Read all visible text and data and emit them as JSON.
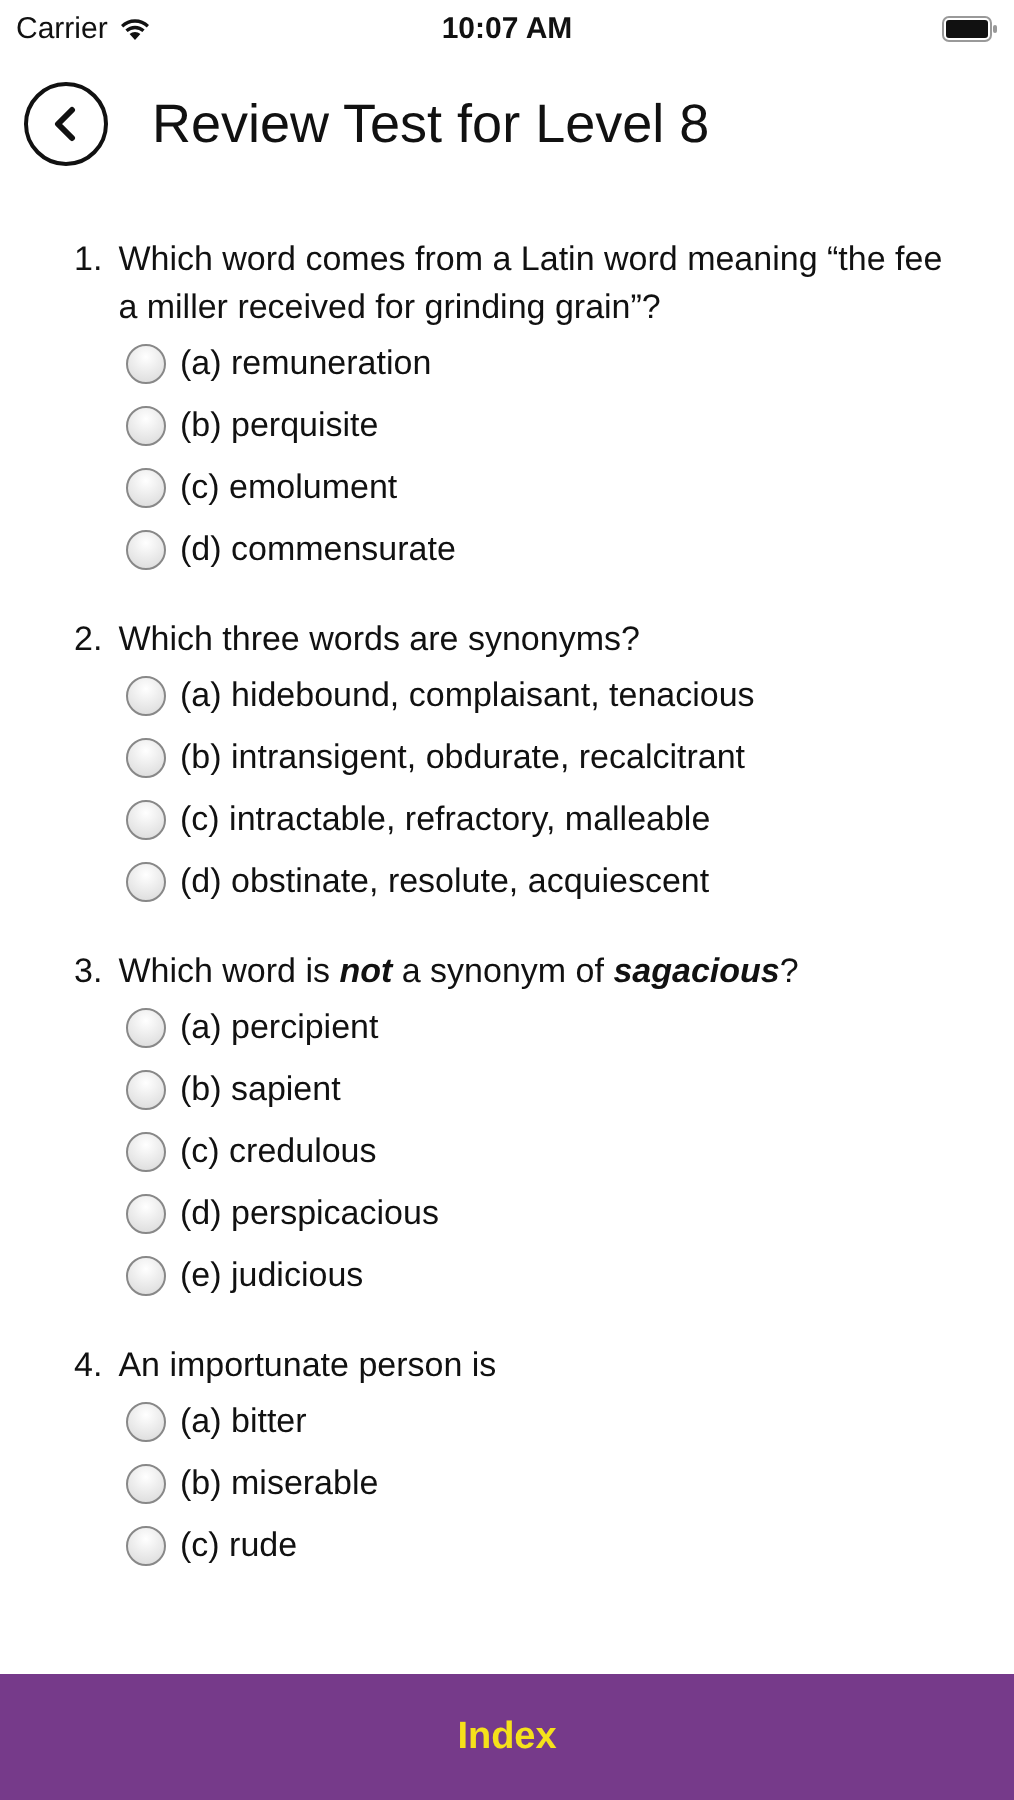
{
  "status_bar": {
    "carrier": "Carrier",
    "time": "10:07 AM"
  },
  "header": {
    "title": "Review Test for Level 8"
  },
  "questions": [
    {
      "number": "1.",
      "text": "Which word comes from a Latin word meaning “the fee a miller received for grinding grain”?",
      "options": [
        {
          "label": "(a) remuneration",
          "selected": false
        },
        {
          "label": "(b) perquisite",
          "selected": false
        },
        {
          "label": "(c) emolument",
          "selected": false
        },
        {
          "label": "(d) commensurate",
          "selected": false
        }
      ]
    },
    {
      "number": "2.",
      "text": "Which three words are synonyms?",
      "options": [
        {
          "label": "(a) hidebound, complaisant, tenacious",
          "selected": false
        },
        {
          "label": "(b) intransigent, obdurate, recalcitrant",
          "selected": false
        },
        {
          "label": "(c) intractable, refractory, malleable",
          "selected": false
        },
        {
          "label": "(d) obstinate, resolute, acquiescent",
          "selected": false
        }
      ]
    },
    {
      "number": "3.",
      "text": "Which word is **not** a synonym of **sagacious**?",
      "options": [
        {
          "label": "(a) percipient",
          "selected": false
        },
        {
          "label": "(b) sapient",
          "selected": false
        },
        {
          "label": "(c) credulous",
          "selected": false
        },
        {
          "label": "(d) perspicacious",
          "selected": false
        },
        {
          "label": "(e) judicious",
          "selected": false
        }
      ]
    },
    {
      "number": "4.",
      "text": "An importunate person is",
      "options": [
        {
          "label": "(a) bitter",
          "selected": false
        },
        {
          "label": "(b) miserable",
          "selected": false
        },
        {
          "label": "(c) rude",
          "selected": false
        }
      ]
    }
  ],
  "footer": {
    "label": "Index"
  }
}
